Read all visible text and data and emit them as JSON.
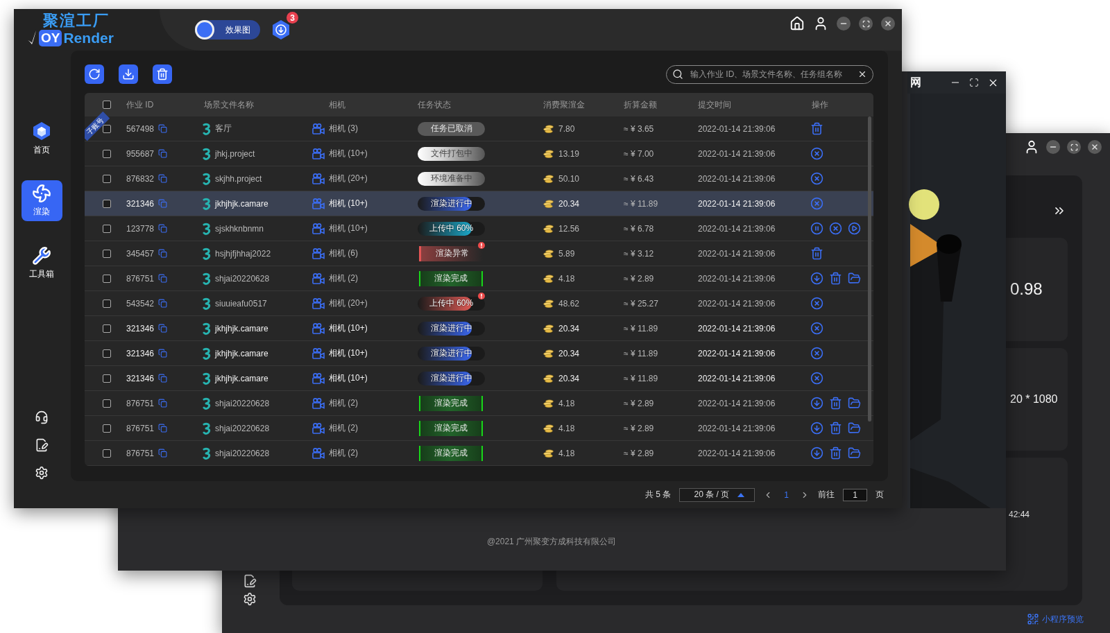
{
  "front_window": {
    "logo": {
      "title": "聚渲工厂",
      "mark": "OY",
      "name": "Render"
    },
    "mode_toggle": {
      "label": "效果图",
      "on": true
    },
    "downloads_badge": "3",
    "sidebar": {
      "items": [
        {
          "label": "首页",
          "kind": "home",
          "selected": false
        },
        {
          "label": "渲染",
          "kind": "render",
          "selected": true
        },
        {
          "label": "工具箱",
          "kind": "tools",
          "selected": false
        }
      ]
    },
    "search": {
      "placeholder": "输入作业 ID、场景文件名称、任务组名称"
    },
    "table": {
      "header_checked": false,
      "columns": [
        "作业 ID",
        "场景文件名称",
        "相机",
        "任务状态",
        "消费聚渲金",
        "折算金额",
        "提交时间",
        "操作"
      ],
      "rows": [
        {
          "checked": false,
          "selected": false,
          "ribbon": "子账号",
          "id": "567498",
          "scene": "客厅",
          "camera": "相机 (3)",
          "status": {
            "kind": "cancelled",
            "label": "任务已取消"
          },
          "alert": false,
          "cost": "7.80",
          "amount": "≈ ¥ 3.65",
          "time": "2022-01-14 21:39:06",
          "actions": [
            {
              "kind": "delete"
            }
          ]
        },
        {
          "checked": false,
          "selected": false,
          "id": "955687",
          "scene": "jhkj.project",
          "camera": "相机 (10+)",
          "status": {
            "kind": "packing",
            "label": "文件打包中"
          },
          "alert": false,
          "cost": "13.19",
          "amount": "≈ ¥ 7.00",
          "time": "2022-01-14 21:39:06",
          "actions": [
            {
              "kind": "cancel"
            }
          ]
        },
        {
          "checked": false,
          "selected": false,
          "id": "876832",
          "scene": "skjhh.project",
          "camera": "相机 (20+)",
          "status": {
            "kind": "preparing",
            "label": "环境准备中"
          },
          "alert": false,
          "cost": "50.10",
          "amount": "≈ ¥ 6.43",
          "time": "2022-01-14 21:39:06",
          "actions": [
            {
              "kind": "cancel"
            }
          ]
        },
        {
          "checked": false,
          "selected": true,
          "id": "321346",
          "scene": "jkhjhjk.camare",
          "camera": "相机 (10+)",
          "status": {
            "kind": "rendering",
            "label": "渲染进行中",
            "level": 0.8
          },
          "alert": false,
          "cost": "20.34",
          "amount": "≈ ¥ 11.89",
          "time": "2022-01-14 21:39:06",
          "actions": [
            {
              "kind": "cancel"
            }
          ]
        },
        {
          "checked": false,
          "selected": false,
          "id": "123778",
          "scene": "sjskhknbnmn",
          "camera": "相机 (10+)",
          "status": {
            "kind": "uploading",
            "label": "上传中 60%",
            "level": 0.8
          },
          "alert": false,
          "cost": "12.56",
          "amount": "≈ ¥ 6.78",
          "time": "2022-01-14 21:39:06",
          "actions": [
            {
              "kind": "pause"
            },
            {
              "kind": "cancel"
            },
            {
              "kind": "play"
            }
          ]
        },
        {
          "checked": false,
          "selected": false,
          "id": "345457",
          "scene": "hsjhjfjhhaj2022",
          "camera": "相机 (6)",
          "status": {
            "kind": "render_failed",
            "label": "渲染异常"
          },
          "alert": true,
          "cost": "5.89",
          "amount": "≈ ¥ 3.12",
          "time": "2022-01-14 21:39:06",
          "actions": [
            {
              "kind": "delete"
            }
          ]
        },
        {
          "checked": false,
          "selected": false,
          "id": "876751",
          "scene": "shjai20220628",
          "camera": "相机 (2)",
          "status": {
            "kind": "done",
            "label": "渲染完成"
          },
          "alert": false,
          "cost": "4.18",
          "amount": "≈ ¥ 2.89",
          "time": "2022-01-14 21:39:06",
          "actions": [
            {
              "kind": "download"
            },
            {
              "kind": "delete"
            },
            {
              "kind": "folder"
            }
          ]
        },
        {
          "checked": false,
          "selected": false,
          "id": "543542",
          "scene": "siuuieafu0517",
          "camera": "相机 (20+)",
          "status": {
            "kind": "upload_failed",
            "label": "上传中 60%",
            "level": 0.8
          },
          "alert": true,
          "cost": "48.62",
          "amount": "≈ ¥ 25.27",
          "time": "2022-01-14 21:39:06",
          "actions": [
            {
              "kind": "cancel"
            }
          ]
        },
        {
          "checked": false,
          "selected": false,
          "id": "321346",
          "scene": "jkhjhjk.camare",
          "camera": "相机 (10+)",
          "status": {
            "kind": "rendering",
            "label": "渲染进行中",
            "level": 0.8
          },
          "alert": false,
          "cost": "20.34",
          "amount": "≈ ¥ 11.89",
          "time": "2022-01-14 21:39:06",
          "actions": [
            {
              "kind": "cancel"
            }
          ]
        },
        {
          "checked": false,
          "selected": false,
          "id": "321346",
          "scene": "jkhjhjk.camare",
          "camera": "相机 (10+)",
          "status": {
            "kind": "rendering",
            "label": "渲染进行中",
            "level": 0.8
          },
          "alert": false,
          "cost": "20.34",
          "amount": "≈ ¥ 11.89",
          "time": "2022-01-14 21:39:06",
          "actions": [
            {
              "kind": "cancel"
            }
          ]
        },
        {
          "checked": false,
          "selected": false,
          "id": "321346",
          "scene": "jkhjhjk.camare",
          "camera": "相机 (10+)",
          "status": {
            "kind": "rendering",
            "label": "渲染进行中",
            "level": 0.8
          },
          "alert": false,
          "cost": "20.34",
          "amount": "≈ ¥ 11.89",
          "time": "2022-01-14 21:39:06",
          "actions": [
            {
              "kind": "cancel"
            }
          ]
        },
        {
          "checked": false,
          "selected": false,
          "id": "876751",
          "scene": "shjai20220628",
          "camera": "相机 (2)",
          "status": {
            "kind": "done",
            "label": "渲染完成"
          },
          "alert": false,
          "cost": "4.18",
          "amount": "≈ ¥ 2.89",
          "time": "2022-01-14 21:39:06",
          "actions": [
            {
              "kind": "download"
            },
            {
              "kind": "delete"
            },
            {
              "kind": "folder"
            }
          ]
        },
        {
          "checked": false,
          "selected": false,
          "id": "876751",
          "scene": "shjai20220628",
          "camera": "相机 (2)",
          "status": {
            "kind": "done",
            "label": "渲染完成"
          },
          "alert": false,
          "cost": "4.18",
          "amount": "≈ ¥ 2.89",
          "time": "2022-01-14 21:39:06",
          "actions": [
            {
              "kind": "download"
            },
            {
              "kind": "delete"
            },
            {
              "kind": "folder"
            }
          ]
        },
        {
          "checked": false,
          "selected": false,
          "id": "876751",
          "scene": "shjai20220628",
          "camera": "相机 (2)",
          "status": {
            "kind": "done",
            "label": "渲染完成"
          },
          "alert": false,
          "cost": "4.18",
          "amount": "≈ ¥ 2.89",
          "time": "2022-01-14 21:39:06",
          "actions": [
            {
              "kind": "download"
            },
            {
              "kind": "delete"
            },
            {
              "kind": "folder"
            }
          ]
        }
      ]
    },
    "pagination": {
      "total": "共 5 条",
      "page_size": "20 条 / 页",
      "pages": [
        {
          "label": "1",
          "selected": true
        }
      ],
      "goto_label": "前往",
      "goto_value": "1",
      "page_suffix": "页"
    }
  },
  "middle_window": {
    "title": "网",
    "footer": "@2021 广州聚变方成科技有限公司"
  },
  "back_window": {
    "card_values": [
      "0.98",
      "20 * 1080"
    ],
    "time_value": "42:44",
    "link": "小程序预览"
  }
}
